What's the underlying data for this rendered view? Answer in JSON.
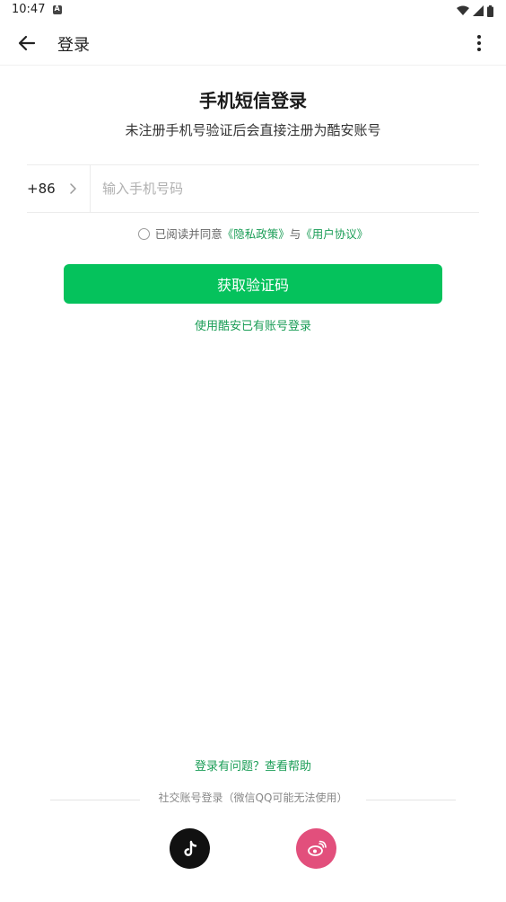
{
  "status_bar": {
    "time": "10:47"
  },
  "app_bar": {
    "title": "登录"
  },
  "headline": "手机短信登录",
  "subheadline": "未注册手机号验证后会直接注册为酷安账号",
  "phone": {
    "country_code": "+86",
    "value": "",
    "placeholder": "输入手机号码"
  },
  "agreement": {
    "prefix": "已阅读并同意",
    "privacy_link": "《隐私政策》",
    "and": "与",
    "terms_link": "《用户协议》"
  },
  "buttons": {
    "get_code": "获取验证码",
    "alt_login": "使用酷安已有账号登录"
  },
  "footer": {
    "help": "登录有问题？查看帮助",
    "social_label": "社交账号登录（微信QQ可能无法使用）"
  },
  "social": [
    {
      "name": "tiktok-icon"
    },
    {
      "name": "weibo-icon"
    }
  ],
  "colors": {
    "accent": "#05c25c",
    "link": "#1a9d56",
    "weibo": "#e24f7c",
    "tiktok": "#111111"
  }
}
